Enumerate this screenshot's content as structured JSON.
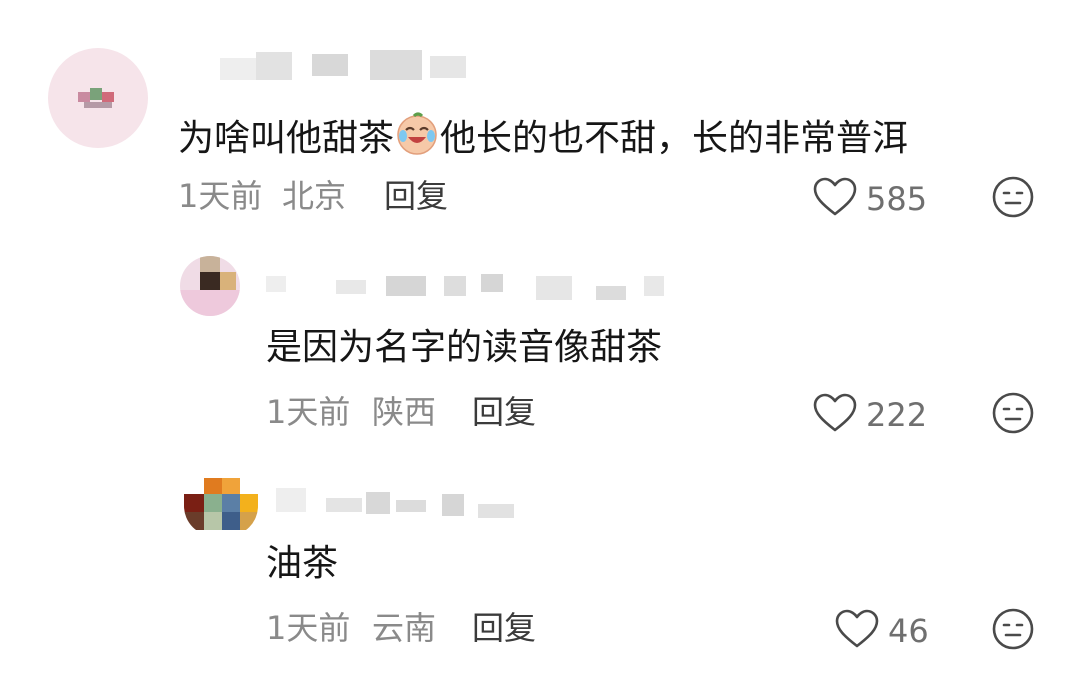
{
  "comments": [
    {
      "text_before_emoji": "为啥叫他甜茶",
      "emoji": "crying-laughing-emoji",
      "text_after_emoji": "他长的也不甜，长的非常普洱",
      "time": "1天前",
      "location": "北京",
      "reply_label": "回复",
      "likes": "585",
      "icons": {
        "like": "heart-outline-icon",
        "dislike": "neutral-face-icon"
      }
    },
    {
      "text": "是因为名字的读音像甜茶",
      "time": "1天前",
      "location": "陕西",
      "reply_label": "回复",
      "likes": "222",
      "icons": {
        "like": "heart-outline-icon",
        "dislike": "neutral-face-icon"
      }
    },
    {
      "text": "油茶",
      "time": "1天前",
      "location": "云南",
      "reply_label": "回复",
      "likes": "46",
      "icons": {
        "like": "heart-outline-icon",
        "dislike": "neutral-face-icon"
      }
    }
  ],
  "colors": {
    "content_text": "#161616",
    "meta_text": "#8a8a8a",
    "reply_text": "#3b3b3b",
    "icon_stroke": "#4a4a4a"
  }
}
